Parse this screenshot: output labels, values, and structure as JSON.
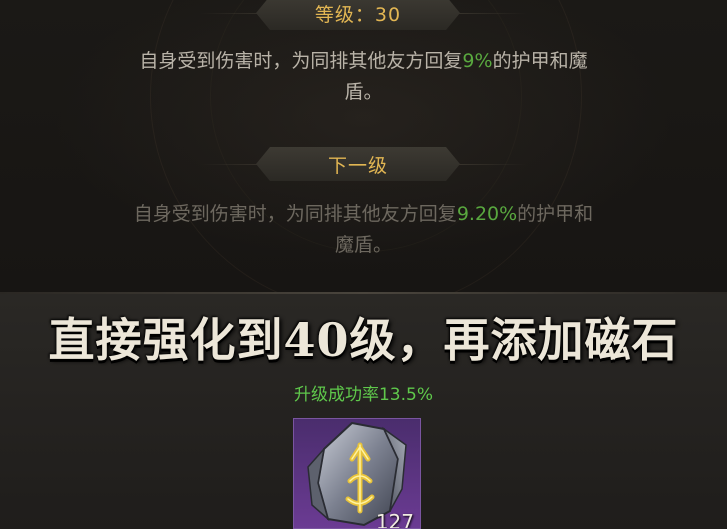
{
  "current": {
    "level_label": "等级：30",
    "desc_prefix": "自身受到伤害时，为同排其他友方回复",
    "desc_value": "9%",
    "desc_suffix_line1": "的护甲和魔",
    "desc_suffix_line2": "盾。"
  },
  "next": {
    "level_label": "下一级",
    "desc_prefix": "自身受到伤害时，为同排其他友方回复",
    "desc_value": "9.20%",
    "desc_suffix_line1": "的护甲和",
    "desc_suffix_line2": "魔盾。"
  },
  "overlay": {
    "headline": "直接强化到40级，再添加磁石"
  },
  "upgrade": {
    "success_rate": "升级成功率13.5%"
  },
  "item": {
    "count": "127",
    "icon": "magnet-stone-icon"
  },
  "colors": {
    "gold": "#e2b653",
    "green_value": "#59a83f",
    "rate_green": "#5fc84b",
    "rarity_purple": "#6b3b93"
  }
}
